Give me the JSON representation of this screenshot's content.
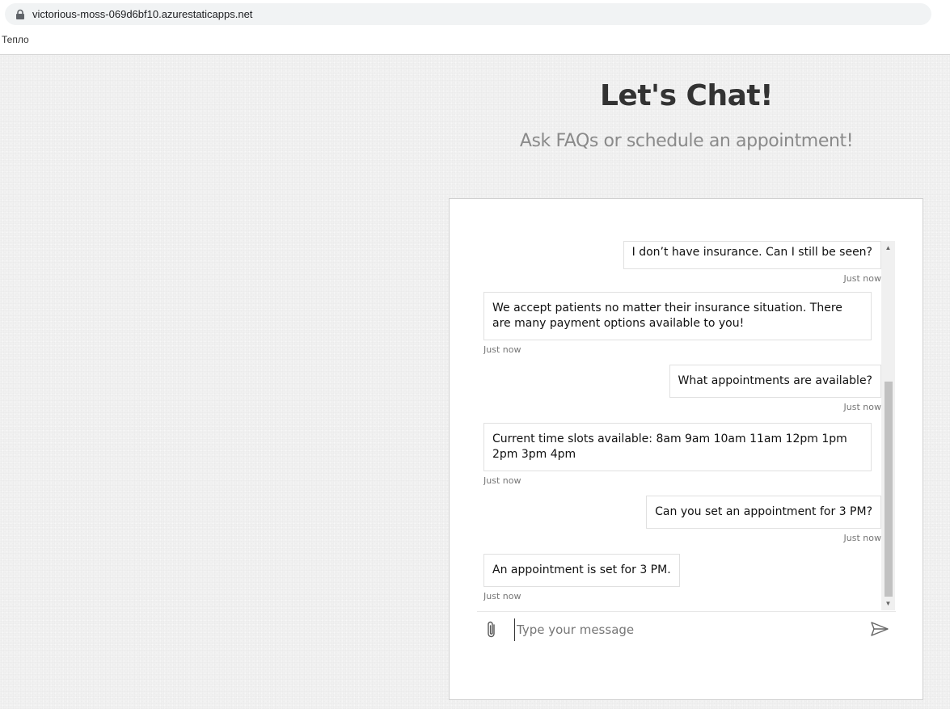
{
  "browser": {
    "url": "victorious-moss-069d6bf10.azurestaticapps.net",
    "bookmark": "Тепло"
  },
  "header": {
    "title": "Let's Chat!",
    "subtitle": "Ask FAQs or schedule an appointment!"
  },
  "chat": {
    "messages": [
      {
        "from": "user",
        "text": "I don’t have insurance. Can I still be seen?",
        "time": "Just now"
      },
      {
        "from": "bot",
        "text": "We accept patients no matter their insurance situation. There are many payment options available to you!",
        "time": "Just now"
      },
      {
        "from": "user",
        "text": "What appointments are available?",
        "time": "Just now"
      },
      {
        "from": "bot",
        "text": "Current time slots available: 8am 9am 10am 11am 12pm 1pm 2pm 3pm 4pm",
        "time": "Just now"
      },
      {
        "from": "user",
        "text": "Can you set an appointment for 3 PM?",
        "time": "Just now"
      },
      {
        "from": "bot",
        "text": "An appointment is set for 3 PM.",
        "time": "Just now"
      }
    ],
    "input": {
      "placeholder": "Type your message",
      "value": ""
    }
  },
  "icons": {
    "lock": "lock-icon",
    "attach": "paperclip-icon",
    "send": "send-icon",
    "scroll_up": "chevron-up-icon",
    "scroll_down": "chevron-down-icon"
  }
}
